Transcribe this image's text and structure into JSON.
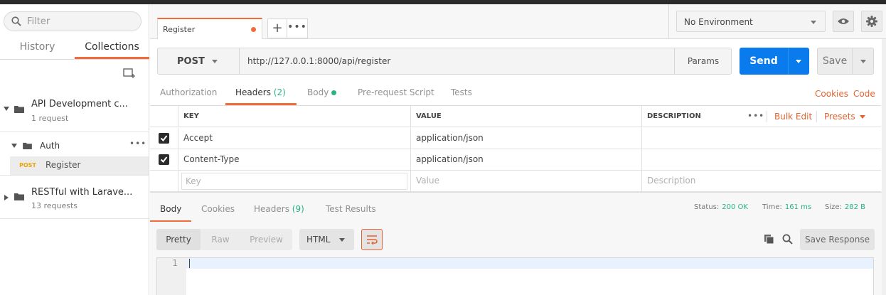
{
  "sidebar": {
    "search_placeholder": "Filter",
    "tabs": [
      {
        "label": "History"
      },
      {
        "label": "Collections"
      }
    ],
    "active_tab": "Collections",
    "collections": [
      {
        "name": "API Development c...",
        "sub": "1 request"
      },
      {
        "name": "RESTful with Larave...",
        "sub": "13 requests"
      }
    ],
    "folder": {
      "name": "Auth",
      "more": "•••"
    },
    "request": {
      "method": "POST",
      "name": "Register"
    }
  },
  "tabs": {
    "request_tab": "Register",
    "add": "+",
    "more": "•••"
  },
  "environment": {
    "selected": "No Environment"
  },
  "request": {
    "method": "POST",
    "url": "http://127.0.0.1:8000/api/register",
    "params_label": "Params",
    "send_label": "Send",
    "save_label": "Save"
  },
  "request_tabs": {
    "authorization": "Authorization",
    "headers": "Headers",
    "headers_count": "(2)",
    "body": "Body",
    "prerequest": "Pre-request Script",
    "tests": "Tests",
    "cookies": "Cookies",
    "code": "Code"
  },
  "headers_table": {
    "columns": {
      "key": "KEY",
      "value": "VALUE",
      "description": "DESCRIPTION"
    },
    "more": "•••",
    "bulk_edit": "Bulk Edit",
    "presets": "Presets",
    "rows": [
      {
        "key": "Accept",
        "value": "application/json",
        "checked": true
      },
      {
        "key": "Content-Type",
        "value": "application/json",
        "checked": true
      }
    ],
    "placeholders": {
      "key": "Key",
      "value": "Value",
      "description": "Description"
    }
  },
  "response": {
    "tabs": {
      "body": "Body",
      "cookies": "Cookies",
      "headers": "Headers",
      "headers_count": "(9)",
      "test_results": "Test Results"
    },
    "status_label": "Status:",
    "status_value": "200 OK",
    "time_label": "Time:",
    "time_value": "161 ms",
    "size_label": "Size:",
    "size_value": "282 B",
    "formats": {
      "pretty": "Pretty",
      "raw": "Raw",
      "preview": "Preview"
    },
    "language": "HTML",
    "save_response": "Save Response",
    "line_number": "1"
  },
  "colors": {
    "accent": "#f26b3a",
    "send": "#097bed",
    "success": "#26b47f",
    "post_method": "#f0a400"
  }
}
